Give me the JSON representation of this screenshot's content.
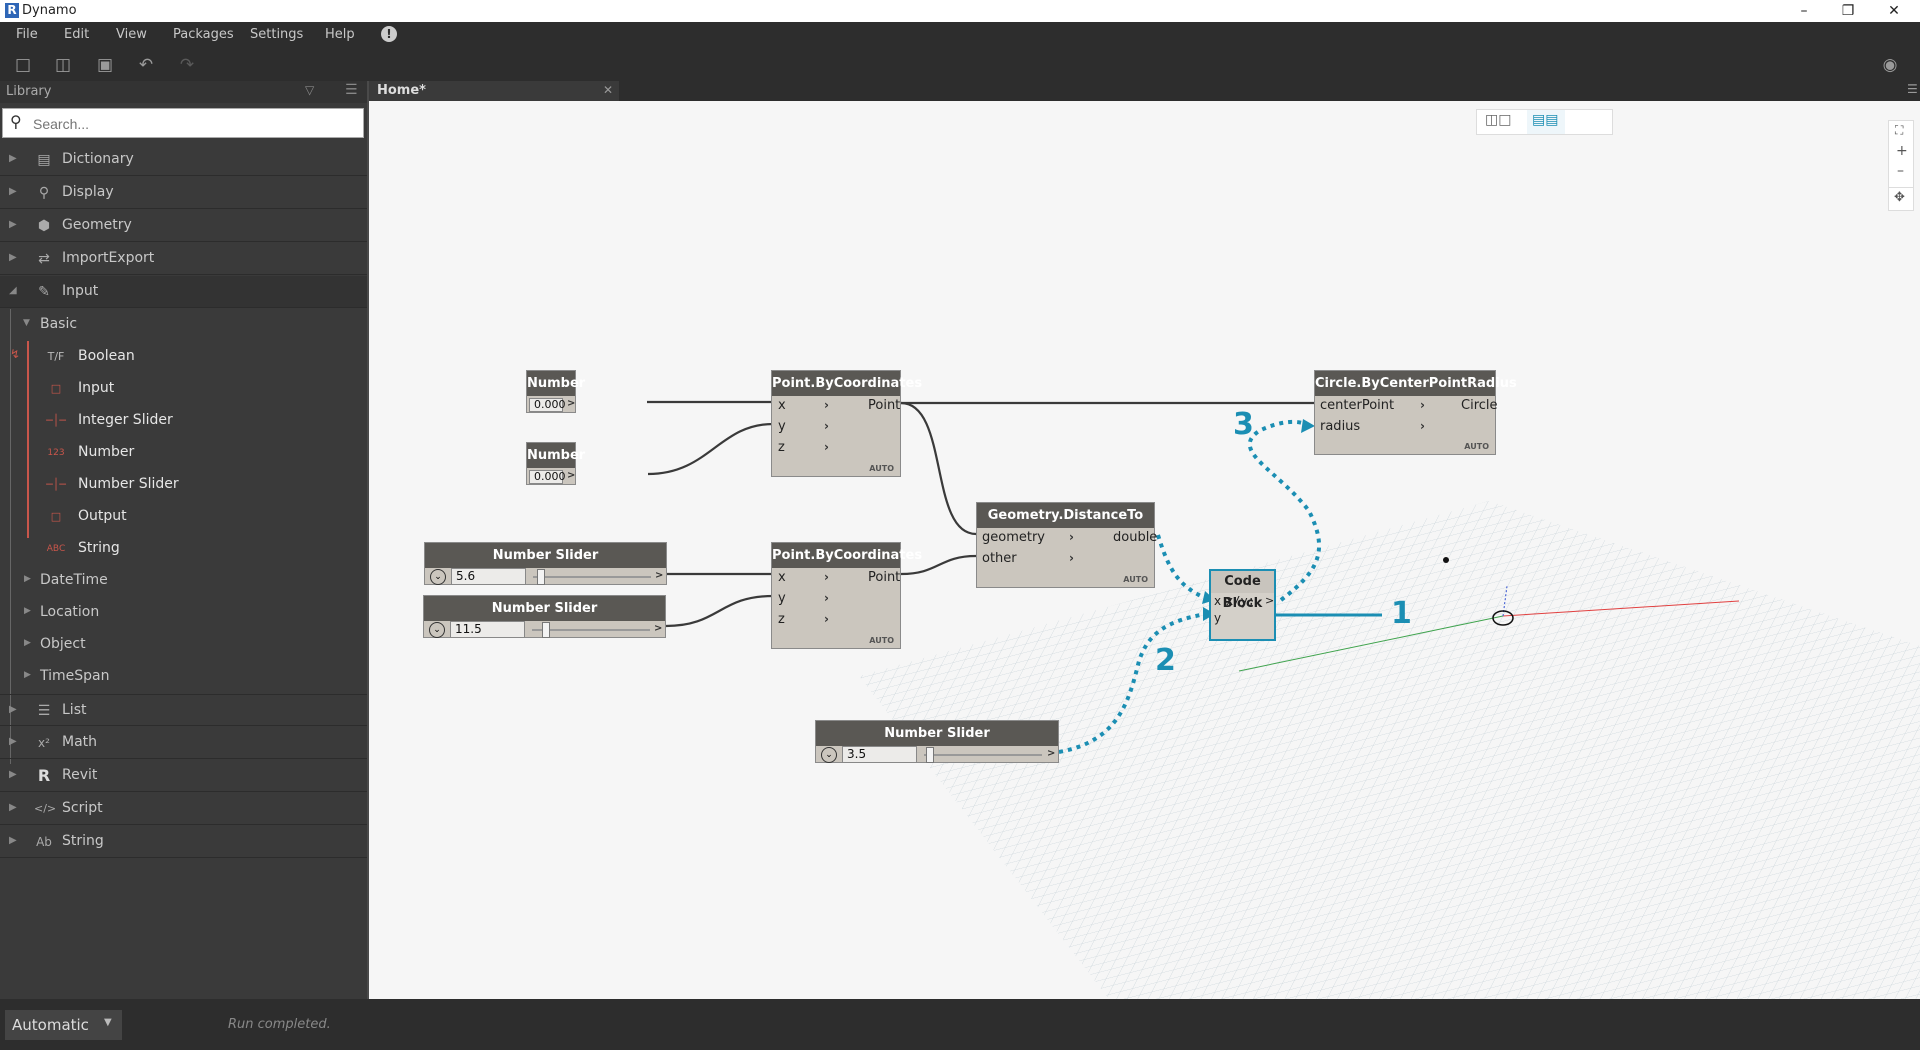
{
  "window": {
    "title": "Dynamo",
    "app_icon": "R"
  },
  "menu": [
    "File",
    "Edit",
    "View",
    "Packages",
    "Settings",
    "Help"
  ],
  "library": {
    "title": "Library",
    "search_placeholder": "Search...",
    "categories": [
      {
        "label": "Dictionary",
        "icon": "dictionary-icon"
      },
      {
        "label": "Display",
        "icon": "magnifier-icon"
      },
      {
        "label": "Geometry",
        "icon": "cube-icon"
      },
      {
        "label": "ImportExport",
        "icon": "arrows-icon"
      },
      {
        "label": "Input",
        "icon": "pencil-icon"
      }
    ],
    "input_sub": "Basic",
    "basic_items": [
      "Boolean",
      "Input",
      "Integer Slider",
      "Number",
      "Number Slider",
      "Output",
      "String"
    ],
    "input_subs": [
      "DateTime",
      "Location",
      "Object",
      "TimeSpan"
    ],
    "bottom_categories": [
      {
        "label": "List",
        "icon": "list-icon"
      },
      {
        "label": "Math",
        "icon": "math-icon"
      },
      {
        "label": "Revit",
        "icon": "revit-icon"
      },
      {
        "label": "Script",
        "icon": "script-icon"
      },
      {
        "label": "String",
        "icon": "string-icon"
      }
    ]
  },
  "tab": {
    "label": "Home*"
  },
  "nodes": {
    "number1": {
      "title": "Number",
      "value": "0.000"
    },
    "number2": {
      "title": "Number",
      "value": "0.000"
    },
    "slider1": {
      "title": "Number Slider",
      "value": "5.6"
    },
    "slider2": {
      "title": "Number Slider",
      "value": "11.5"
    },
    "slider3": {
      "title": "Number Slider",
      "value": "3.5"
    },
    "pbc1": {
      "title": "Point.ByCoordinates",
      "inputs": [
        "x",
        "y",
        "z"
      ],
      "output": "Point",
      "lacing": "AUTO"
    },
    "pbc2": {
      "title": "Point.ByCoordinates",
      "inputs": [
        "x",
        "y",
        "z"
      ],
      "output": "Point",
      "lacing": "AUTO"
    },
    "distance": {
      "title": "Geometry.DistanceTo",
      "inputs": [
        "geometry",
        "other"
      ],
      "output": "double",
      "lacing": "AUTO"
    },
    "codeblock": {
      "title": "Code Block",
      "inputs": [
        "x",
        "y"
      ],
      "code": "x/y;",
      "output": ">"
    },
    "circle": {
      "title": "Circle.ByCenterPointRadius",
      "inputs": [
        "centerPoint",
        "radius"
      ],
      "output": "Circle",
      "lacing": "AUTO"
    }
  },
  "callouts": [
    "1",
    "2",
    "3"
  ],
  "status": {
    "run_mode": "Automatic",
    "message": "Run completed."
  },
  "colors": {
    "accent": "#1b8eb3",
    "chrome": "#2d2d2d",
    "node_body": "#cbc6be",
    "node_header": "#5a5854"
  }
}
